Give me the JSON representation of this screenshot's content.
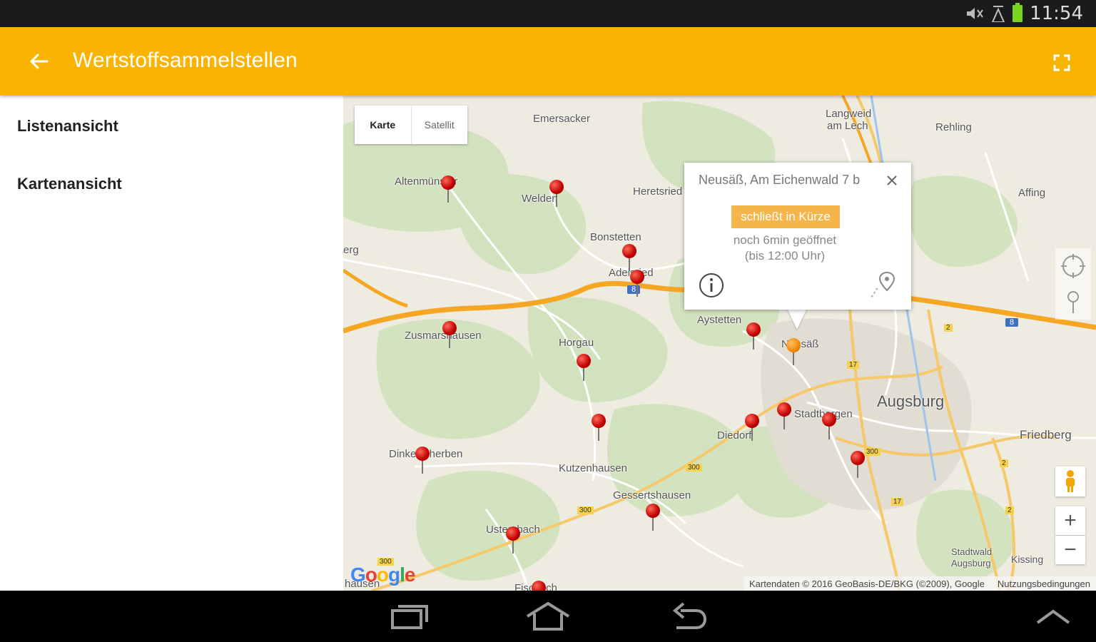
{
  "status_bar": {
    "time": "11:54"
  },
  "app_bar": {
    "title": "Wertstoffsammelstellen"
  },
  "sidebar": {
    "items": [
      {
        "label": "Listenansicht"
      },
      {
        "label": "Kartenansicht"
      }
    ]
  },
  "map": {
    "map_type": {
      "map_label": "Karte",
      "satellite_label": "Satellit",
      "selected": "Karte"
    },
    "places": {
      "emersacker": "Emersacker",
      "langweid": "Langweid",
      "am_lech": "am Lech",
      "rehling": "Rehling",
      "altenmuenster": "Altenmünster",
      "welden": "Welden",
      "heretsried": "Heretsried",
      "affing": "Affing",
      "bonstetten": "Bonstetten",
      "adelsried": "Adelsried",
      "erg": "erg",
      "zusmarshausen": "Zusmarshausen",
      "horgau": "Horgau",
      "aystetten": "Aystetten",
      "neusaess": "Neusäß",
      "augsburg": "Augsburg",
      "stadtbergen": "Stadtbergen",
      "friedberg": "Friedberg",
      "diedorf": "Diedorf",
      "dinkelscherben": "Dinkelscherben",
      "kutzenhausen": "Kutzenhausen",
      "gessertshausen": "Gessertshausen",
      "ustersbach": "Ustersbach",
      "stadtwald": "Stadtwald",
      "stadtwald2": "Augsburg",
      "kissing": "Kissing",
      "fischach": "Fischach",
      "hausen": "hausen"
    },
    "road_labels": {
      "a8_left": "8",
      "a8_right": "8",
      "b17a": "17",
      "b17b": "17",
      "b2a": "2",
      "b2b": "2",
      "b2c": "2",
      "b300a": "300",
      "b300b": "300",
      "b300c": "300",
      "b300d": "300"
    },
    "popup": {
      "title": "Neusäß, Am Eichenwald 7 b",
      "badge": "schließt in Kürze",
      "status_line1": "noch 6min geöffnet",
      "status_line2": "(bis 12:00 Uhr)"
    },
    "zoom_in_label": "+",
    "zoom_out_label": "−",
    "attribution": "Kartendaten © 2016 GeoBasis-DE/BKG (©2009), Google",
    "terms": "Nutzungsbedingungen",
    "colors": {
      "app_bar": "#f8b400",
      "pin": "#c00000",
      "pin_selected": "#f08a00",
      "badge": "#f5b54a",
      "highway": "#f5a623"
    },
    "icons": {
      "back": "arrow-left-icon",
      "fullscreen": "fullscreen-icon",
      "close": "close-icon",
      "info": "info-icon",
      "route": "route-icon",
      "locate": "my-location-icon",
      "pegman": "pegman-icon"
    }
  },
  "nav_bar": {
    "icons": [
      "recent-apps-icon",
      "home-icon",
      "back-icon",
      "collapse-icon"
    ]
  }
}
